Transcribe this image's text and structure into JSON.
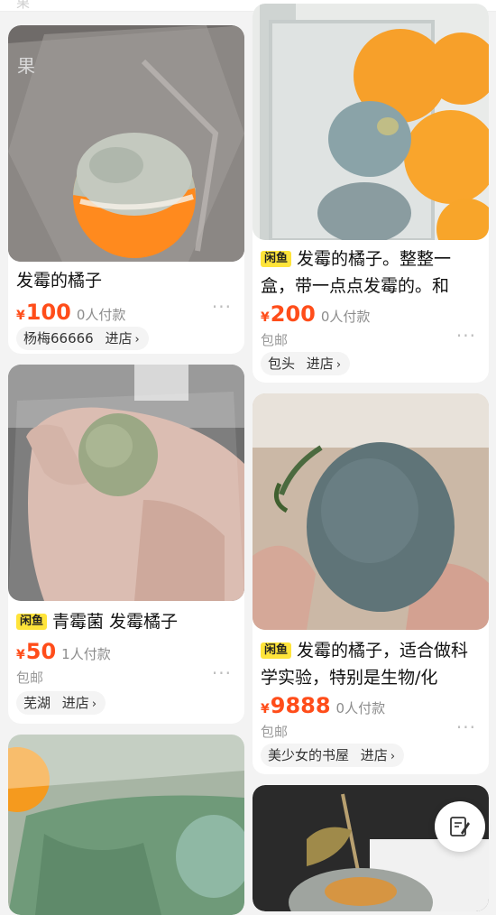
{
  "top_strip": {
    "ghost_text": "果"
  },
  "listings": [
    {
      "id": "l1",
      "title": "发霉的橘子",
      "tag": "",
      "currency": "¥",
      "price": "100",
      "buyers": "0人付款",
      "shipping": "",
      "shop": "杨梅66666",
      "shop_action": "进店"
    },
    {
      "id": "r1",
      "title": "发霉的橘子。整整一盒，带一点点发霉的。和",
      "tag": "闲鱼",
      "currency": "¥",
      "price": "200",
      "buyers": "0人付款",
      "shipping": "包邮",
      "shop": "包头",
      "shop_action": "进店"
    },
    {
      "id": "l2",
      "title": "青霉菌   发霉橘子",
      "tag": "闲鱼",
      "currency": "¥",
      "price": "50",
      "buyers": "1人付款",
      "shipping": "包邮",
      "shop": "芜湖",
      "shop_action": "进店"
    },
    {
      "id": "r2",
      "title": "发霉的橘子，适合做科学实验，特别是生物/化",
      "tag": "闲鱼",
      "currency": "¥",
      "price": "9888",
      "buyers": "0人付款",
      "shipping": "包邮",
      "shop": "美少女的书屋",
      "shop_action": "进店"
    }
  ],
  "more_icon": "more-dots-icon",
  "fab_icon": "edit-note-icon",
  "colors": {
    "price": "#ff4d1a",
    "tag_bg": "#ffe43a",
    "card_bg": "#ffffff",
    "page_bg": "#f3f3f3"
  }
}
